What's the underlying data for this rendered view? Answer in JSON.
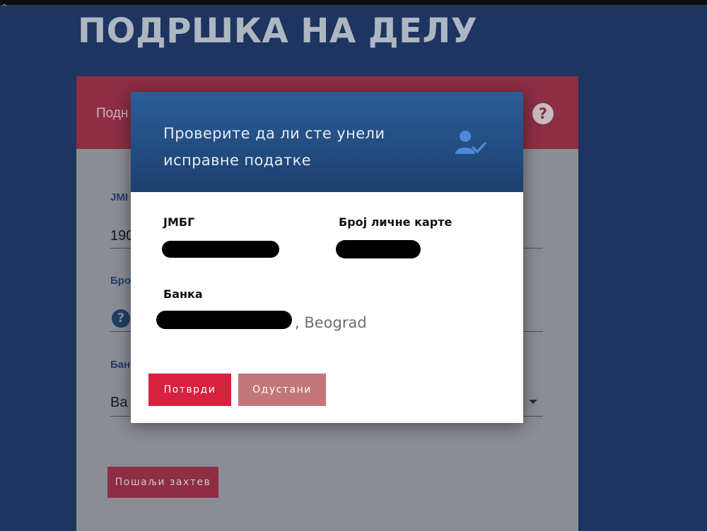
{
  "page": {
    "title": "ПОДРШКА НА ДЕЛУ"
  },
  "background_form": {
    "header_label": "Подн",
    "fields": [
      {
        "label": "JMI",
        "value": "190"
      },
      {
        "label": "Бро"
      },
      {
        "label": "Бан",
        "value": "Ва"
      }
    ],
    "help_icon": "question-circle-icon",
    "submit_label": "Пошаљи захтев"
  },
  "modal": {
    "title_line1": "Проверите да ли сте унели",
    "title_line2": "исправне податке",
    "icon": "user-check-icon",
    "jmbg_label": "ЈМБГ",
    "id_card_label": "Број личне карте",
    "bank_label": "Банка",
    "bank_value_visible": ", Beograd",
    "confirm_label": "Потврди",
    "cancel_label": "Одустани"
  },
  "colors": {
    "page_background": "#1d3560",
    "modal_header": "#1c3f6f",
    "confirm_button": "#d6213f",
    "cancel_button": "#c27677",
    "accent_icon": "#4d8ad6"
  }
}
